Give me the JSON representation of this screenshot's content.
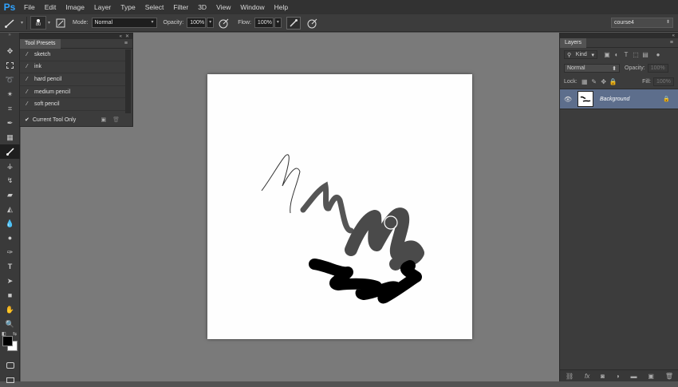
{
  "app": {
    "logo": "Ps"
  },
  "menu": [
    "File",
    "Edit",
    "Image",
    "Layer",
    "Type",
    "Select",
    "Filter",
    "3D",
    "View",
    "Window",
    "Help"
  ],
  "options": {
    "brush_size": "80",
    "mode_label": "Mode:",
    "mode_value": "Normal",
    "opacity_label": "Opacity:",
    "opacity_value": "100%",
    "flow_label": "Flow:",
    "flow_value": "100%",
    "workspace_value": "course4"
  },
  "tool_presets": {
    "title": "Tool Presets",
    "items": [
      "sketch",
      "ink",
      "hard pencil",
      "medium pencil",
      "soft pencil"
    ],
    "current_only_label": "Current Tool Only"
  },
  "layers": {
    "title": "Layers",
    "filter_label": "Kind",
    "blend_value": "Normal",
    "opacity_label": "Opacity:",
    "opacity_value": "100%",
    "lock_label": "Lock:",
    "fill_label": "Fill:",
    "fill_value": "100%",
    "layer_name": "Background"
  },
  "colors": {
    "accent_logo": "#2fa3ff",
    "layer_selected": "#5d6e8c",
    "foreground": "#000000",
    "background": "#ffffff"
  }
}
